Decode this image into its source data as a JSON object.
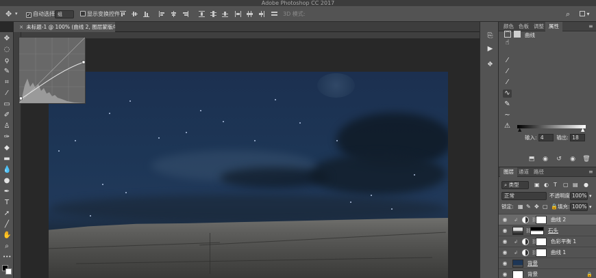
{
  "app": {
    "title": "Adobe Photoshop CC 2017"
  },
  "options_bar": {
    "auto_select_label": "自动选择:",
    "auto_select_checked": true,
    "auto_select_value": "组",
    "show_transform_label": "显示变换控件",
    "show_transform_checked": false,
    "mode_3d_label": "3D 模式:"
  },
  "document": {
    "tab_title": "未标题-1 @ 100% (曲线 2, 图层蒙版/8) *"
  },
  "properties_panel": {
    "tabs": [
      "颜色",
      "色板",
      "调整",
      "属性"
    ],
    "active_tab": 3,
    "adjustment_name": "曲线",
    "input_label": "输入:",
    "input_value": "4",
    "output_label": "输出:",
    "output_value": "18"
  },
  "layers_panel": {
    "tabs": [
      "图层",
      "通道",
      "路径"
    ],
    "active_tab": 0,
    "filter_kind": "类型",
    "blend_mode": "正常",
    "opacity_label": "不透明度:",
    "opacity_value": "100%",
    "lock_label": "锁定:",
    "fill_label": "填充:",
    "fill_value": "100%",
    "layers": [
      {
        "name": "曲线 2",
        "type": "curves",
        "clipped": true,
        "selected": true
      },
      {
        "name": "石头",
        "type": "image-mask",
        "clipped": false,
        "selected": false
      },
      {
        "name": "色彩平衡 1",
        "type": "balance",
        "clipped": true,
        "selected": false
      },
      {
        "name": "曲线 1",
        "type": "curves",
        "clipped": true,
        "selected": false
      },
      {
        "name": "背景",
        "type": "image",
        "clipped": false,
        "selected": false
      },
      {
        "name": "背景",
        "type": "locked",
        "clipped": false,
        "selected": false
      }
    ]
  },
  "colors": {
    "ui_dark": "#282828",
    "ui_panel": "#535353",
    "sky": "#1d3656",
    "rock": "#5d5d5b"
  }
}
